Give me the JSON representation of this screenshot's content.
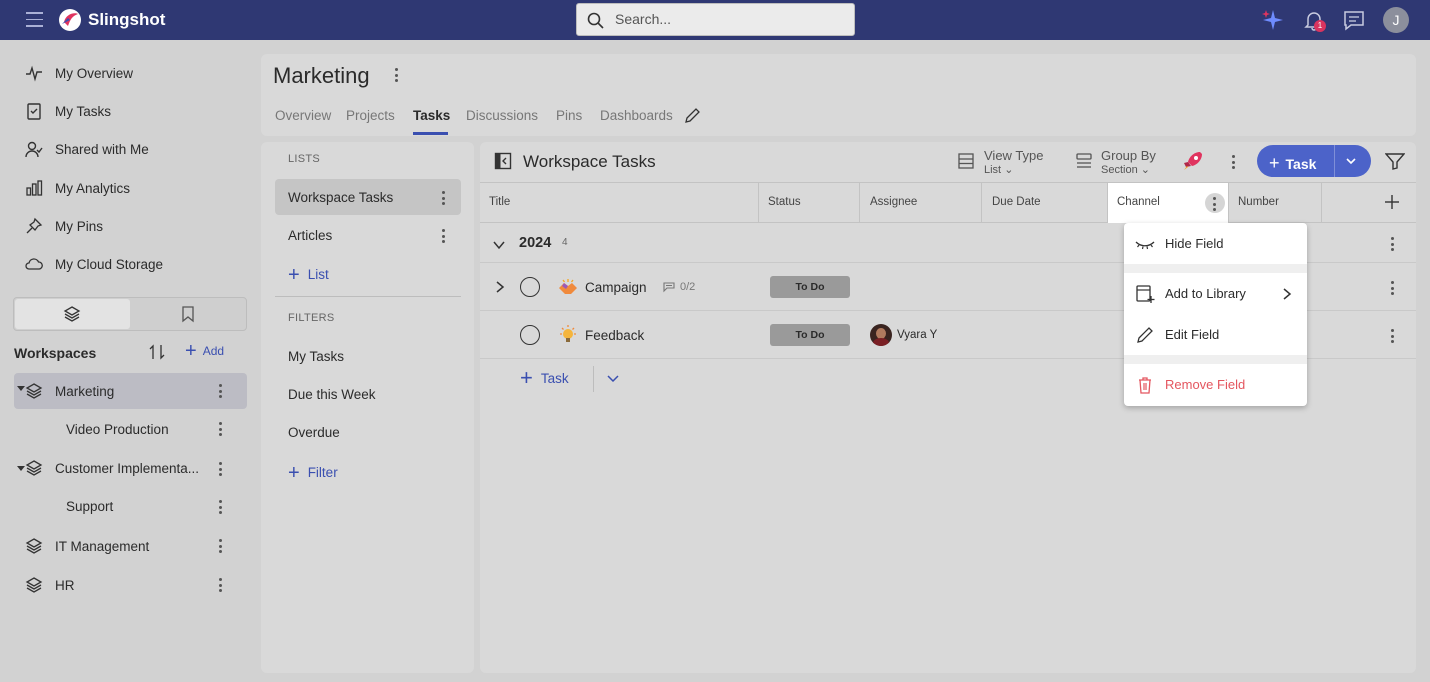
{
  "app": {
    "name": "Slingshot"
  },
  "search": {
    "placeholder": "Search..."
  },
  "topbar": {
    "notification_count": "1",
    "user_initial": "J"
  },
  "nav": {
    "items": [
      {
        "label": "My Overview",
        "icon": "pulse-icon"
      },
      {
        "label": "My Tasks",
        "icon": "clipboard-check-icon"
      },
      {
        "label": "Shared with Me",
        "icon": "user-check-icon"
      },
      {
        "label": "My Analytics",
        "icon": "bar-chart-icon"
      },
      {
        "label": "My Pins",
        "icon": "pin-icon"
      },
      {
        "label": "My Cloud Storage",
        "icon": "cloud-icon"
      }
    ]
  },
  "workspaces": {
    "label": "Workspaces",
    "add_label": "Add",
    "items": [
      {
        "label": "Marketing"
      },
      {
        "label": "Video Production"
      },
      {
        "label": "Customer Implementa..."
      },
      {
        "label": "Support"
      },
      {
        "label": "IT Management"
      },
      {
        "label": "HR"
      }
    ]
  },
  "page": {
    "title": "Marketing",
    "tabs": [
      {
        "label": "Overview"
      },
      {
        "label": "Projects"
      },
      {
        "label": "Tasks"
      },
      {
        "label": "Discussions"
      },
      {
        "label": "Pins"
      },
      {
        "label": "Dashboards"
      }
    ],
    "active_tab": "Tasks"
  },
  "lists_panel": {
    "lists_label": "LISTS",
    "lists": [
      {
        "label": "Workspace Tasks"
      },
      {
        "label": "Articles"
      }
    ],
    "add_list_label": "List",
    "filters_label": "FILTERS",
    "filters": [
      {
        "label": "My Tasks"
      },
      {
        "label": "Due this Week"
      },
      {
        "label": "Overdue"
      }
    ],
    "add_filter_label": "Filter"
  },
  "main": {
    "title": "Workspace Tasks",
    "view_type": {
      "label": "View Type",
      "value": "List"
    },
    "group_by": {
      "label": "Group By",
      "value": "Section"
    },
    "add_task_label": "Task",
    "columns": [
      {
        "label": "Title"
      },
      {
        "label": "Status"
      },
      {
        "label": "Assignee"
      },
      {
        "label": "Due Date"
      },
      {
        "label": "Channel"
      },
      {
        "label": "Number"
      }
    ],
    "group": {
      "name": "2024",
      "count": "4"
    },
    "tasks": [
      {
        "title": "Campaign",
        "status": "To Do",
        "assignee": "",
        "subtasks": "0/2"
      },
      {
        "title": "Feedback",
        "status": "To Do",
        "assignee": "Vyara Y",
        "subtasks": ""
      }
    ],
    "add_row_label": "Task"
  },
  "context_menu": {
    "items": [
      {
        "label": "Hide Field",
        "icon": "eye-closed-icon"
      },
      {
        "label": "Add to Library",
        "icon": "library-add-icon"
      },
      {
        "label": "Edit Field",
        "icon": "pencil-icon"
      },
      {
        "label": "Remove Field",
        "icon": "trash-icon"
      }
    ]
  },
  "colors": {
    "topbar": "#2f3873",
    "accent": "#4c63c9",
    "danger": "#e4565f"
  }
}
